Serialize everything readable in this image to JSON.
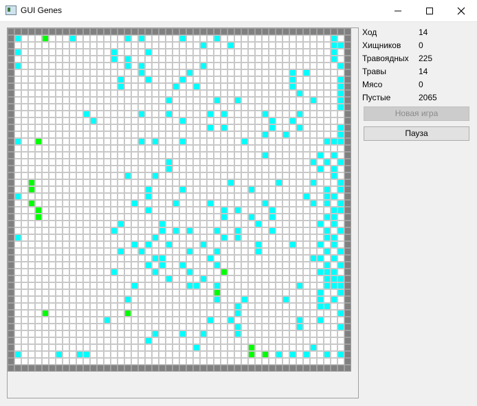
{
  "window": {
    "title": "GUI Genes"
  },
  "stats": [
    {
      "label": "Ход",
      "value": "14"
    },
    {
      "label": "Хищников",
      "value": "0"
    },
    {
      "label": "Травоядных",
      "value": "225"
    },
    {
      "label": "Травы",
      "value": "14"
    },
    {
      "label": "Мясо",
      "value": "0"
    },
    {
      "label": "Пустые",
      "value": "2065"
    }
  ],
  "buttons": {
    "new_game": "Новая игра",
    "pause": "Пауза"
  },
  "colors": {
    "wall": "#808080",
    "herbivore": "#00ffff",
    "grass": "#00ff00",
    "empty": "#ffffff",
    "gridline": "#c8c8c8"
  },
  "board": {
    "cols": 50,
    "rows": 50,
    "herbivores": [
      [
        1,
        1
      ],
      [
        9,
        1
      ],
      [
        17,
        1
      ],
      [
        19,
        1
      ],
      [
        25,
        1
      ],
      [
        30,
        1
      ],
      [
        47,
        1
      ],
      [
        28,
        2
      ],
      [
        32,
        2
      ],
      [
        47,
        2
      ],
      [
        48,
        2
      ],
      [
        1,
        3
      ],
      [
        15,
        3
      ],
      [
        20,
        3
      ],
      [
        47,
        3
      ],
      [
        15,
        4
      ],
      [
        17,
        4
      ],
      [
        47,
        4
      ],
      [
        1,
        5
      ],
      [
        17,
        5
      ],
      [
        19,
        5
      ],
      [
        28,
        5
      ],
      [
        48,
        5
      ],
      [
        19,
        6
      ],
      [
        26,
        6
      ],
      [
        41,
        6
      ],
      [
        43,
        6
      ],
      [
        16,
        7
      ],
      [
        20,
        7
      ],
      [
        25,
        7
      ],
      [
        41,
        7
      ],
      [
        48,
        7
      ],
      [
        16,
        8
      ],
      [
        24,
        8
      ],
      [
        27,
        8
      ],
      [
        41,
        8
      ],
      [
        48,
        8
      ],
      [
        42,
        9
      ],
      [
        48,
        9
      ],
      [
        23,
        10
      ],
      [
        30,
        10
      ],
      [
        33,
        10
      ],
      [
        44,
        10
      ],
      [
        48,
        10
      ],
      [
        48,
        11
      ],
      [
        11,
        12
      ],
      [
        19,
        12
      ],
      [
        23,
        12
      ],
      [
        29,
        12
      ],
      [
        31,
        12
      ],
      [
        37,
        12
      ],
      [
        42,
        12
      ],
      [
        12,
        13
      ],
      [
        25,
        13
      ],
      [
        38,
        13
      ],
      [
        41,
        13
      ],
      [
        29,
        14
      ],
      [
        31,
        14
      ],
      [
        38,
        14
      ],
      [
        42,
        14
      ],
      [
        48,
        14
      ],
      [
        37,
        15
      ],
      [
        40,
        15
      ],
      [
        48,
        15
      ],
      [
        1,
        16
      ],
      [
        19,
        16
      ],
      [
        21,
        16
      ],
      [
        25,
        16
      ],
      [
        34,
        16
      ],
      [
        46,
        16
      ],
      [
        47,
        16
      ],
      [
        48,
        16
      ],
      [
        37,
        18
      ],
      [
        45,
        18
      ],
      [
        47,
        18
      ],
      [
        23,
        19
      ],
      [
        44,
        19
      ],
      [
        46,
        19
      ],
      [
        48,
        19
      ],
      [
        23,
        20
      ],
      [
        45,
        20
      ],
      [
        47,
        20
      ],
      [
        17,
        21
      ],
      [
        21,
        21
      ],
      [
        47,
        21
      ],
      [
        32,
        22
      ],
      [
        39,
        22
      ],
      [
        44,
        22
      ],
      [
        48,
        22
      ],
      [
        20,
        23
      ],
      [
        25,
        23
      ],
      [
        35,
        23
      ],
      [
        46,
        23
      ],
      [
        48,
        23
      ],
      [
        1,
        24
      ],
      [
        20,
        24
      ],
      [
        43,
        24
      ],
      [
        46,
        24
      ],
      [
        47,
        24
      ],
      [
        18,
        25
      ],
      [
        24,
        25
      ],
      [
        29,
        25
      ],
      [
        37,
        25
      ],
      [
        44,
        25
      ],
      [
        46,
        25
      ],
      [
        48,
        25
      ],
      [
        20,
        26
      ],
      [
        31,
        26
      ],
      [
        33,
        26
      ],
      [
        38,
        26
      ],
      [
        47,
        26
      ],
      [
        48,
        26
      ],
      [
        31,
        27
      ],
      [
        35,
        27
      ],
      [
        38,
        27
      ],
      [
        46,
        27
      ],
      [
        47,
        27
      ],
      [
        16,
        28
      ],
      [
        22,
        28
      ],
      [
        36,
        28
      ],
      [
        45,
        28
      ],
      [
        47,
        28
      ],
      [
        15,
        29
      ],
      [
        22,
        29
      ],
      [
        24,
        29
      ],
      [
        26,
        29
      ],
      [
        30,
        29
      ],
      [
        33,
        29
      ],
      [
        38,
        29
      ],
      [
        46,
        29
      ],
      [
        48,
        29
      ],
      [
        1,
        30
      ],
      [
        21,
        30
      ],
      [
        31,
        30
      ],
      [
        33,
        30
      ],
      [
        46,
        30
      ],
      [
        47,
        30
      ],
      [
        18,
        31
      ],
      [
        20,
        31
      ],
      [
        23,
        31
      ],
      [
        28,
        31
      ],
      [
        36,
        31
      ],
      [
        41,
        31
      ],
      [
        45,
        31
      ],
      [
        47,
        31
      ],
      [
        16,
        32
      ],
      [
        19,
        32
      ],
      [
        26,
        32
      ],
      [
        30,
        32
      ],
      [
        36,
        32
      ],
      [
        46,
        32
      ],
      [
        48,
        32
      ],
      [
        21,
        33
      ],
      [
        22,
        33
      ],
      [
        29,
        33
      ],
      [
        44,
        33
      ],
      [
        45,
        33
      ],
      [
        47,
        33
      ],
      [
        20,
        34
      ],
      [
        22,
        34
      ],
      [
        25,
        34
      ],
      [
        30,
        34
      ],
      [
        46,
        34
      ],
      [
        48,
        34
      ],
      [
        15,
        35
      ],
      [
        21,
        35
      ],
      [
        26,
        35
      ],
      [
        45,
        35
      ],
      [
        46,
        35
      ],
      [
        47,
        35
      ],
      [
        23,
        36
      ],
      [
        28,
        36
      ],
      [
        46,
        36
      ],
      [
        47,
        36
      ],
      [
        48,
        36
      ],
      [
        18,
        37
      ],
      [
        26,
        37
      ],
      [
        27,
        37
      ],
      [
        30,
        37
      ],
      [
        42,
        37
      ],
      [
        46,
        37
      ],
      [
        47,
        37
      ],
      [
        48,
        37
      ],
      [
        45,
        38
      ],
      [
        48,
        38
      ],
      [
        17,
        39
      ],
      [
        30,
        39
      ],
      [
        34,
        39
      ],
      [
        40,
        39
      ],
      [
        45,
        39
      ],
      [
        47,
        39
      ],
      [
        33,
        40
      ],
      [
        45,
        40
      ],
      [
        46,
        40
      ],
      [
        33,
        41
      ],
      [
        48,
        41
      ],
      [
        14,
        42
      ],
      [
        29,
        42
      ],
      [
        32,
        42
      ],
      [
        42,
        42
      ],
      [
        45,
        42
      ],
      [
        33,
        43
      ],
      [
        42,
        43
      ],
      [
        48,
        43
      ],
      [
        21,
        44
      ],
      [
        25,
        44
      ],
      [
        28,
        44
      ],
      [
        33,
        44
      ],
      [
        20,
        45
      ],
      [
        27,
        46
      ],
      [
        44,
        46
      ],
      [
        1,
        47
      ],
      [
        7,
        47
      ],
      [
        10,
        47
      ],
      [
        11,
        47
      ],
      [
        39,
        47
      ],
      [
        41,
        47
      ],
      [
        43,
        47
      ],
      [
        46,
        47
      ],
      [
        48,
        47
      ]
    ],
    "grass": [
      [
        5,
        1
      ],
      [
        4,
        16
      ],
      [
        3,
        22
      ],
      [
        3,
        23
      ],
      [
        3,
        25
      ],
      [
        4,
        26
      ],
      [
        4,
        27
      ],
      [
        31,
        35
      ],
      [
        30,
        38
      ],
      [
        5,
        41
      ],
      [
        17,
        41
      ],
      [
        35,
        46
      ],
      [
        35,
        47
      ],
      [
        37,
        47
      ]
    ]
  }
}
